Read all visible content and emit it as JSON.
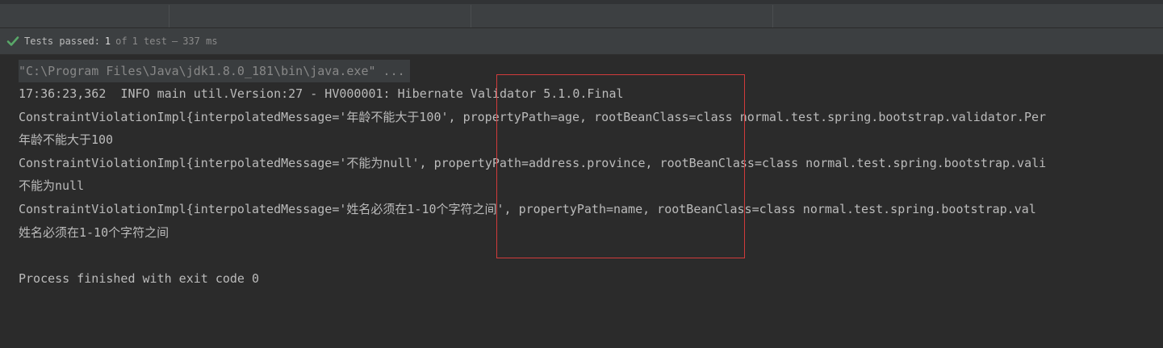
{
  "status": {
    "label": "Tests passed:",
    "passed": "1",
    "of_label": "of",
    "total": "1 test",
    "separator": "–",
    "duration": "337 ms"
  },
  "console": {
    "lines": [
      "\"C:\\Program Files\\Java\\jdk1.8.0_181\\bin\\java.exe\" ...",
      "17:36:23,362  INFO main util.Version:27 - HV000001: Hibernate Validator 5.1.0.Final",
      "ConstraintViolationImpl{interpolatedMessage='年龄不能大于100', propertyPath=age, rootBeanClass=class normal.test.spring.bootstrap.validator.Per",
      "年龄不能大于100",
      "ConstraintViolationImpl{interpolatedMessage='不能为null', propertyPath=address.province, rootBeanClass=class normal.test.spring.bootstrap.vali",
      "不能为null",
      "ConstraintViolationImpl{interpolatedMessage='姓名必须在1-10个字符之间', propertyPath=name, rootBeanClass=class normal.test.spring.bootstrap.val",
      "姓名必须在1-10个字符之间",
      "",
      "Process finished with exit code 0"
    ]
  },
  "colors": {
    "background": "#2b2b2b",
    "text": "#bbbbbb",
    "success_check": "#59a869",
    "highlight_box": "#d13b3b"
  },
  "icons": {
    "status": "check-icon"
  }
}
